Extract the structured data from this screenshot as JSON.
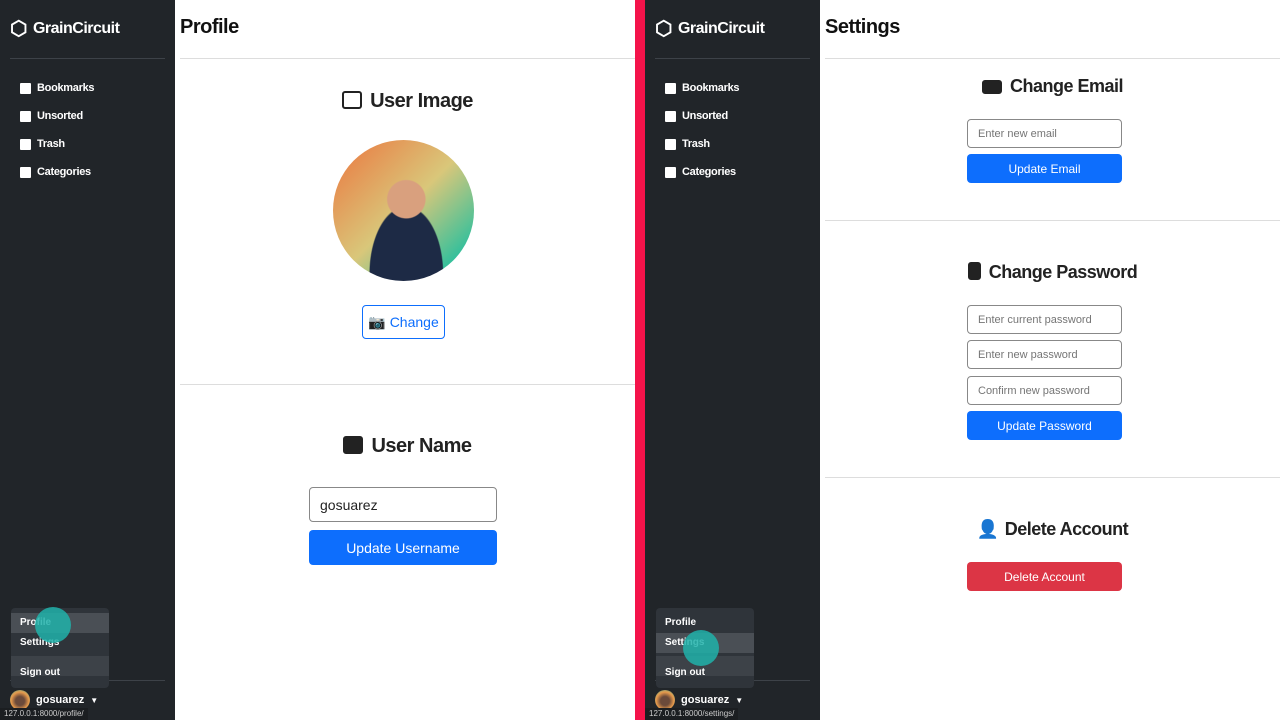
{
  "brand": "GrainCircuit",
  "sidebar": {
    "items": [
      {
        "label": "Bookmarks",
        "icon": "bookmark-icon"
      },
      {
        "label": "Unsorted",
        "icon": "archive-icon"
      },
      {
        "label": "Trash",
        "icon": "trash-icon"
      },
      {
        "label": "Categories",
        "icon": "folder-icon"
      }
    ]
  },
  "user_menu": {
    "items": [
      "Profile",
      "Settings",
      "Sign out"
    ],
    "username": "gosuarez"
  },
  "profile": {
    "title": "Profile",
    "url": "127.0.0.1:8000/profile/",
    "image_heading": "User Image",
    "change_label": "Change",
    "name_heading": "User Name",
    "username_value": "gosuarez",
    "update_username": "Update Username"
  },
  "settings": {
    "title": "Settings",
    "url": "127.0.0.1:8000/settings/",
    "email_heading": "Change Email",
    "email_placeholder": "Enter new email",
    "update_email": "Update Email",
    "password_heading": "Change Password",
    "current_pw_placeholder": "Enter current password",
    "new_pw_placeholder": "Enter new password",
    "confirm_pw_placeholder": "Confirm new password",
    "update_password": "Update Password",
    "delete_heading": "Delete Account",
    "delete_label": "Delete Account"
  },
  "colors": {
    "primary": "#0d6efd",
    "danger": "#dc3545",
    "sidebar": "#212529",
    "divider": "#f4134a"
  }
}
